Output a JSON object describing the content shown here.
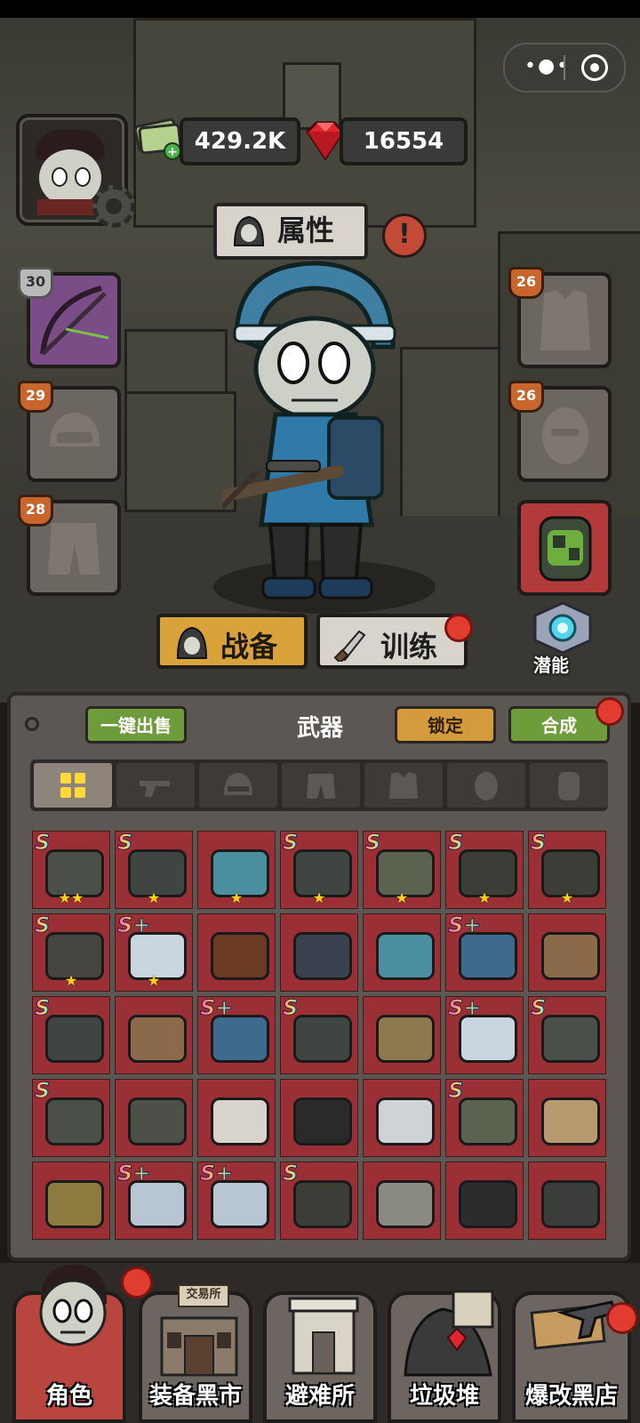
{
  "capsule": {
    "menu_glyph": "•●•"
  },
  "resources": {
    "cash": "429.2K",
    "gems": "16554"
  },
  "header": {
    "attr_tab": "属性",
    "alert_glyph": "!"
  },
  "left_slots": [
    {
      "level": "30",
      "kind": "crossbow"
    },
    {
      "level": "29",
      "kind": "helmet"
    },
    {
      "level": "28",
      "kind": "pants"
    }
  ],
  "right_slots": [
    {
      "level": "26",
      "kind": "vest"
    },
    {
      "level": "26",
      "kind": "mask"
    },
    {
      "level": "",
      "kind": "backpack"
    }
  ],
  "tabs": {
    "gear": "战备",
    "training": "训练",
    "potential": "潜能"
  },
  "panel": {
    "sell_all": "一键出售",
    "category_title": "武器",
    "lock": "锁定",
    "combine": "合成"
  },
  "filters": [
    "all-icon",
    "gun-icon",
    "helmet-icon",
    "pants-icon",
    "vest-icon",
    "mask-icon",
    "backpack-icon"
  ],
  "inventory": [
    {
      "rank": "S",
      "stars": "★★",
      "item": "helmet-icon",
      "color": "#4a4f4a"
    },
    {
      "rank": "S",
      "stars": "★",
      "item": "minigun-icon",
      "color": "#3f4540"
    },
    {
      "rank": "",
      "stars": "★",
      "item": "launcher-icon",
      "color": "#4a8ea0"
    },
    {
      "rank": "S",
      "stars": "★",
      "item": "minigun-icon",
      "color": "#3f4540"
    },
    {
      "rank": "S",
      "stars": "★",
      "item": "boots-icon",
      "color": "#5b6250"
    },
    {
      "rank": "S",
      "stars": "★",
      "item": "armor-icon",
      "color": "#3b3d36"
    },
    {
      "rank": "S",
      "stars": "★",
      "item": "armor-icon",
      "color": "#3b3d36"
    },
    {
      "rank": "S",
      "stars": "★",
      "item": "gasmask-icon",
      "color": "#45443f"
    },
    {
      "rank": "S+",
      "stars": "★",
      "item": "helmet-icon",
      "color": "#c9d6e0"
    },
    {
      "rank": "",
      "stars": "",
      "item": "rifle-icon",
      "color": "#6b3a22"
    },
    {
      "rank": "",
      "stars": "",
      "item": "rifle-icon",
      "color": "#3a4250"
    },
    {
      "rank": "",
      "stars": "",
      "item": "launcher-icon",
      "color": "#4a8ea0"
    },
    {
      "rank": "S+",
      "stars": "",
      "item": "rifle-icon",
      "color": "#3e6a8e"
    },
    {
      "rank": "",
      "stars": "",
      "item": "rifle-icon",
      "color": "#8a6a4a"
    },
    {
      "rank": "S",
      "stars": "",
      "item": "minigun-icon",
      "color": "#3f4540"
    },
    {
      "rank": "",
      "stars": "",
      "item": "rifle-icon",
      "color": "#8a6a4a"
    },
    {
      "rank": "S+",
      "stars": "",
      "item": "rifle-icon",
      "color": "#3e6a8e"
    },
    {
      "rank": "S",
      "stars": "",
      "item": "minigun-icon",
      "color": "#3f4540"
    },
    {
      "rank": "",
      "stars": "",
      "item": "helmet-icon",
      "color": "#8c7a4e"
    },
    {
      "rank": "S+",
      "stars": "",
      "item": "helmet-icon",
      "color": "#c9d6e0"
    },
    {
      "rank": "S",
      "stars": "",
      "item": "helmet-icon",
      "color": "#4a4f4a"
    },
    {
      "rank": "S",
      "stars": "",
      "item": "helmet-icon",
      "color": "#4a4f4a"
    },
    {
      "rank": "",
      "stars": "",
      "item": "gasmask-icon",
      "color": "#4c5048"
    },
    {
      "rank": "",
      "stars": "",
      "item": "sneaker-icon",
      "color": "#d8d4cc"
    },
    {
      "rank": "",
      "stars": "",
      "item": "boots-icon",
      "color": "#2a2a2a"
    },
    {
      "rank": "",
      "stars": "",
      "item": "boots-icon",
      "color": "#cfd3d8"
    },
    {
      "rank": "S",
      "stars": "",
      "item": "boots-icon",
      "color": "#5b6250"
    },
    {
      "rank": "",
      "stars": "",
      "item": "vest-icon",
      "color": "#b89a70"
    },
    {
      "rank": "",
      "stars": "",
      "item": "vest-icon",
      "color": "#8c7a3e"
    },
    {
      "rank": "S+",
      "stars": "",
      "item": "armor-icon",
      "color": "#b8c6d4"
    },
    {
      "rank": "S+",
      "stars": "",
      "item": "armor-icon",
      "color": "#b8c6d4"
    },
    {
      "rank": "S",
      "stars": "",
      "item": "armor-icon",
      "color": "#3b3d36"
    },
    {
      "rank": "",
      "stars": "",
      "item": "mask-icon",
      "color": "#8a8a80"
    },
    {
      "rank": "",
      "stars": "",
      "item": "goggles-icon",
      "color": "#2c2c2c"
    },
    {
      "rank": "",
      "stars": "",
      "item": "backpack-icon",
      "color": "#3a3d3a"
    }
  ],
  "nav": {
    "trade_sign": "交易所",
    "items": [
      {
        "label": "角色"
      },
      {
        "label": "装备黑市"
      },
      {
        "label": "避难所"
      },
      {
        "label": "垃圾堆"
      },
      {
        "label": "爆改黑店"
      }
    ]
  }
}
